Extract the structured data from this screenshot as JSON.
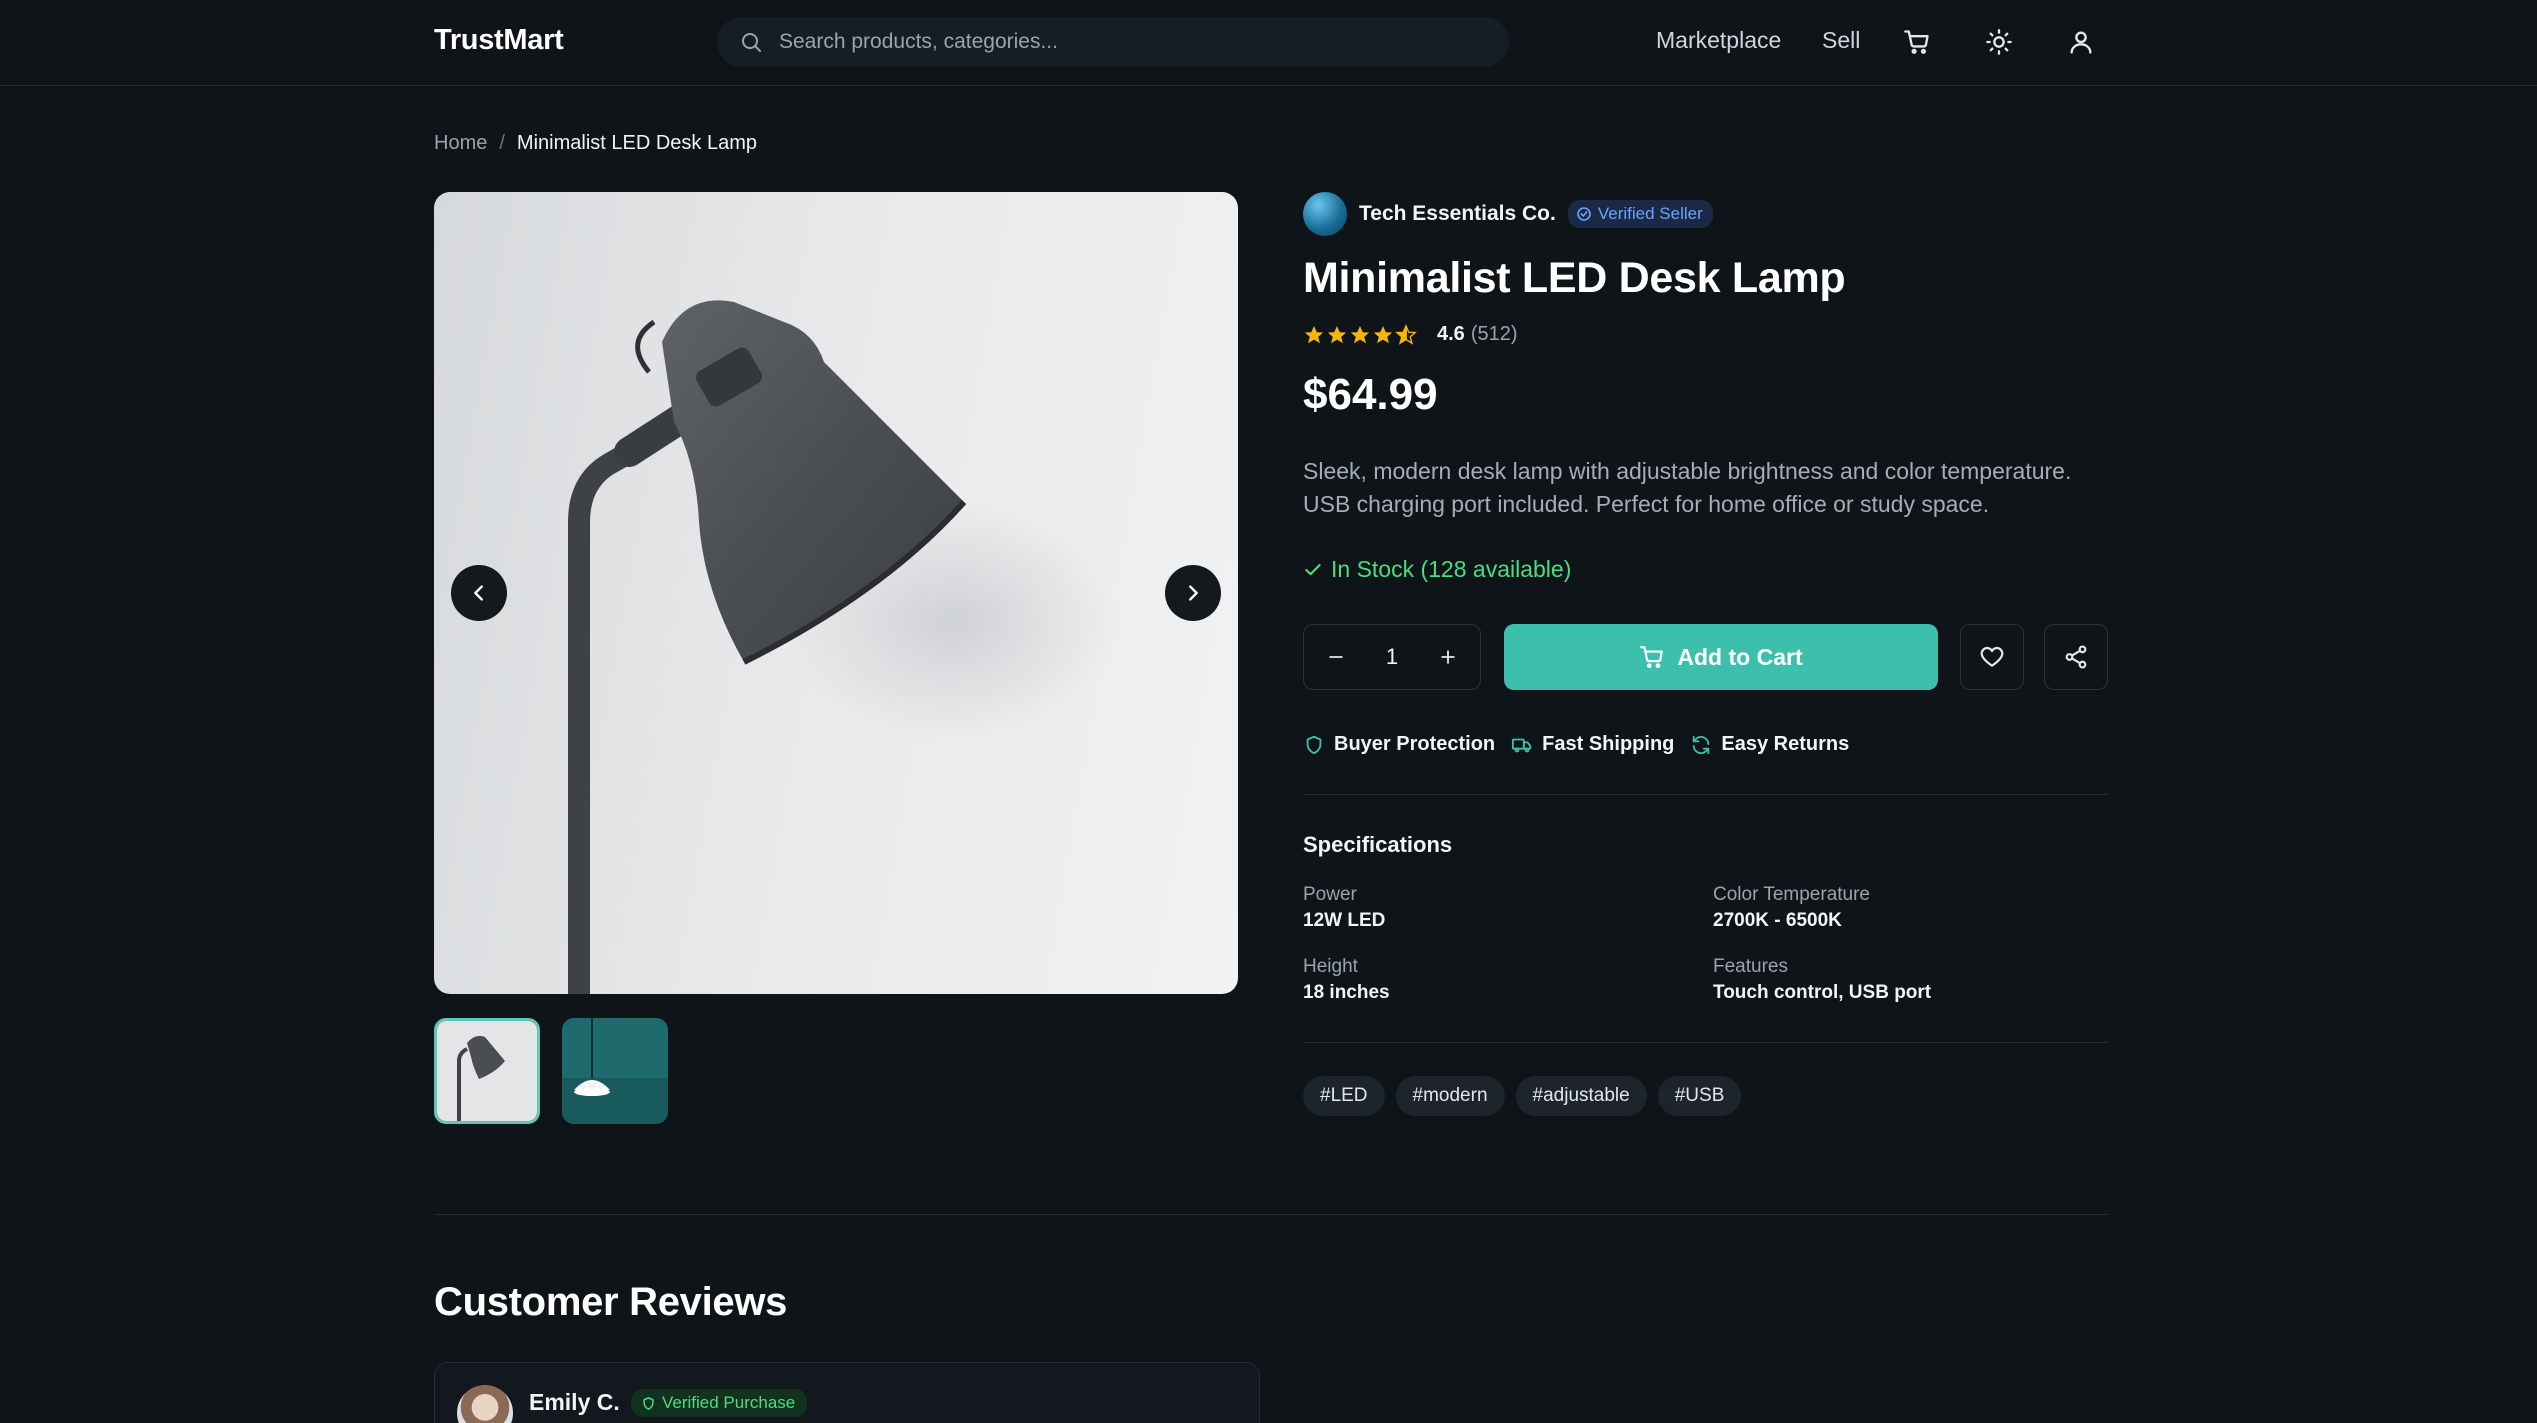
{
  "header": {
    "logo": "TrustMart",
    "search_placeholder": "Search products, categories...",
    "nav": {
      "marketplace": "Marketplace",
      "sell": "Sell"
    }
  },
  "breadcrumb": {
    "home": "Home",
    "separator": "/",
    "current": "Minimalist LED Desk Lamp"
  },
  "seller": {
    "name": "Tech Essentials Co.",
    "badge": "Verified Seller"
  },
  "product": {
    "title": "Minimalist LED Desk Lamp",
    "rating": {
      "value": "4.6",
      "count": "(512)",
      "stars": 4.6
    },
    "price": "$64.99",
    "description": "Sleek, modern desk lamp with adjustable brightness and color temperature. USB charging port included. Perfect for home office or study space.",
    "stock": "In Stock (128 available)",
    "quantity": "1",
    "add_to_cart": "Add to Cart"
  },
  "features": [
    "Buyer Protection",
    "Fast Shipping",
    "Easy Returns"
  ],
  "specifications": {
    "title": "Specifications",
    "items": [
      {
        "label": "Power",
        "value": "12W LED"
      },
      {
        "label": "Color Temperature",
        "value": "2700K - 6500K"
      },
      {
        "label": "Height",
        "value": "18 inches"
      },
      {
        "label": "Features",
        "value": "Touch control, USB port"
      }
    ]
  },
  "tags": [
    "#LED",
    "#modern",
    "#adjustable",
    "#USB"
  ],
  "reviews": {
    "title": "Customer Reviews",
    "first": {
      "name": "Emily C.",
      "badge": "Verified Purchase"
    }
  },
  "colors": {
    "background": "#0f1419",
    "accent": "#3dbfae",
    "stock_green": "#4ade80",
    "verified_blue": "#6aa3ff",
    "star": "#f5b50a"
  },
  "icons": [
    "search-icon",
    "cart-icon",
    "sun-icon",
    "user-icon",
    "chevron-left-icon",
    "chevron-right-icon",
    "check-icon",
    "minus-icon",
    "plus-icon",
    "heart-icon",
    "share-icon",
    "shield-icon",
    "truck-icon",
    "refresh-icon"
  ]
}
